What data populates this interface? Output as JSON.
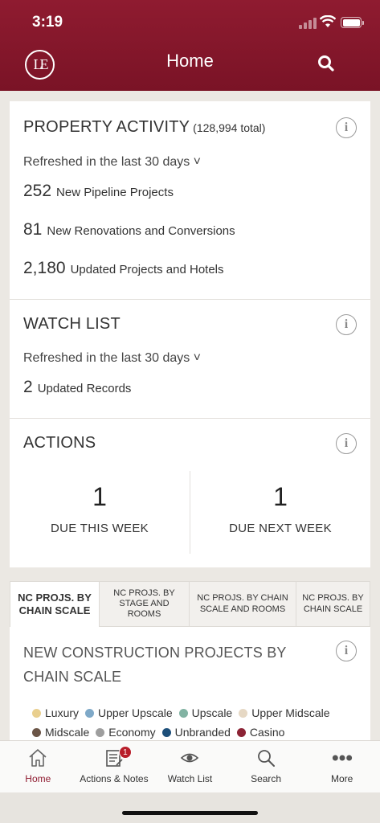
{
  "status_bar": {
    "time": "3:19"
  },
  "header": {
    "logo_text": "LE",
    "title": "Home"
  },
  "property_activity": {
    "title": "PROPERTY ACTIVITY",
    "total": "(128,994 total)",
    "refreshed": "Refreshed in the last 30 days ˅",
    "stats": [
      {
        "num": "252",
        "label": "New Pipeline Projects"
      },
      {
        "num": "81",
        "label": "New Renovations and Conversions"
      },
      {
        "num": "2,180",
        "label": "Updated Projects and Hotels"
      }
    ]
  },
  "watch_list": {
    "title": "WATCH LIST",
    "refreshed": "Refreshed in the last 30 days ˅",
    "stat": {
      "num": "2",
      "label": "Updated Records"
    }
  },
  "actions": {
    "title": "ACTIONS",
    "this_week": {
      "num": "1",
      "label": "DUE THIS WEEK"
    },
    "next_week": {
      "num": "1",
      "label": "DUE NEXT WEEK"
    }
  },
  "tabs": [
    {
      "label": "NC PROJS. BY CHAIN SCALE",
      "active": true
    },
    {
      "label": "NC PROJS. BY STAGE AND ROOMS",
      "active": false
    },
    {
      "label": "NC PROJS. BY CHAIN SCALE AND ROOMS",
      "active": false
    },
    {
      "label": "NC PROJS. BY CHAIN SCALE",
      "active": false
    }
  ],
  "chart_section": {
    "title": "NEW CONSTRUCTION PROJECTS BY CHAIN SCALE",
    "legend": [
      {
        "label": "Luxury",
        "color": "#e9cf8e"
      },
      {
        "label": "Upper Upscale",
        "color": "#7fa9c8"
      },
      {
        "label": "Upscale",
        "color": "#82b3a3"
      },
      {
        "label": "Upper Midscale",
        "color": "#e6d8c4"
      },
      {
        "label": "Midscale",
        "color": "#6b5547"
      },
      {
        "label": "Economy",
        "color": "#9e9e9e"
      },
      {
        "label": "Unbranded",
        "color": "#1d4f7a"
      },
      {
        "label": "Casino",
        "color": "#8c2335"
      }
    ]
  },
  "bottom_nav": {
    "items": [
      {
        "label": "Home",
        "icon": "home-icon"
      },
      {
        "label": "Actions & Notes",
        "icon": "notes-icon",
        "badge": "1"
      },
      {
        "label": "Watch List",
        "icon": "eye-icon"
      },
      {
        "label": "Search",
        "icon": "search-icon"
      },
      {
        "label": "More",
        "icon": "more-icon"
      }
    ]
  }
}
